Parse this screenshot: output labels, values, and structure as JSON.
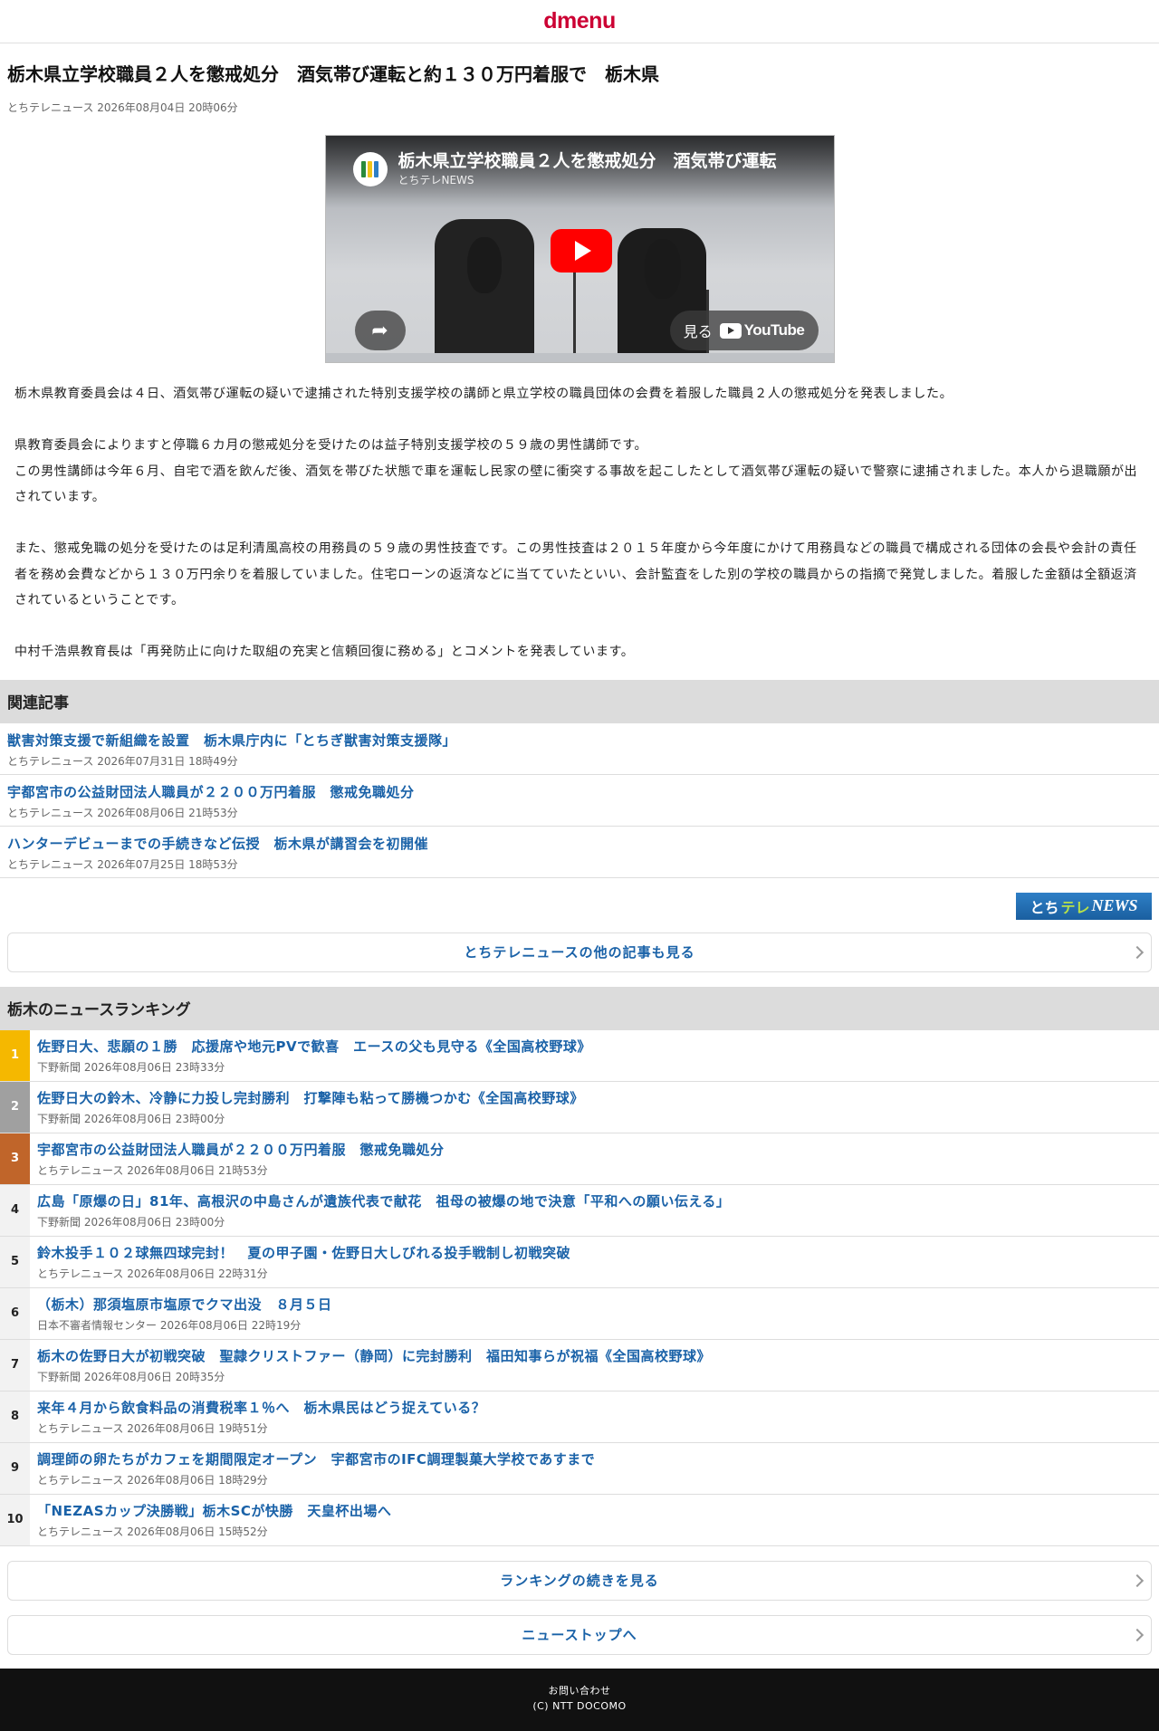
{
  "header": {
    "logo": "dmenu"
  },
  "article": {
    "title": "栃木県立学校職員２人を懲戒処分　酒気帯び運転と約１３０万円着服で　栃木県",
    "source": "とちテレニュース",
    "datetime": "2026年08月04日 20時06分",
    "video": {
      "title": "栃木県立学校職員２人を懲戒処分　酒気帯び運転",
      "channel": "とちテレNEWS",
      "watch_label": "見る",
      "youtube_label": "YouTube"
    },
    "paragraphs": [
      "栃木県教育委員会は４日、酒気帯び運転の疑いで逮捕された特別支援学校の講師と県立学校の職員団体の会費を着服した職員２人の懲戒処分を発表しました。",
      "",
      "県教育委員会によりますと停職６カ月の懲戒処分を受けたのは益子特別支援学校の５９歳の男性講師です。",
      "この男性講師は今年６月、自宅で酒を飲んだ後、酒気を帯びた状態で車を運転し民家の壁に衝突する事故を起こしたとして酒気帯び運転の疑いで警察に逮捕されました。本人から退職願が出されています。",
      "",
      "また、懲戒免職の処分を受けたのは足利清風高校の用務員の５９歳の男性技査です。この男性技査は２０１５年度から今年度にかけて用務員などの職員で構成される団体の会長や会計の責任者を務め会費などから１３０万円余りを着服していました。住宅ローンの返済などに当てていたといい、会計監査をした別の学校の職員からの指摘で発覚しました。着服した金額は全額返済されているということです。",
      "",
      "中村千浩県教育長は「再発防止に向けた取組の充実と信頼回復に務める」とコメントを発表しています。"
    ]
  },
  "related": {
    "heading": "関連記事",
    "items": [
      {
        "title": "獣害対策支援で新組織を設置　栃木県庁内に「とちぎ獣害対策支援隊」",
        "source": "とちテレニュース",
        "datetime": "2026年07月31日 18時49分"
      },
      {
        "title": "宇都宮市の公益財団法人職員が２２００万円着服　懲戒免職処分",
        "source": "とちテレニュース",
        "datetime": "2026年08月06日 21時53分"
      },
      {
        "title": "ハンターデビューまでの手続きなど伝授　栃木県が講習会を初開催",
        "source": "とちテレニュース",
        "datetime": "2026年07月25日 18時53分"
      }
    ],
    "brand_logo": {
      "prefix": "とち",
      "mid": "テレ",
      "suffix": "NEWS"
    },
    "more_label": "とちテレニュースの他の記事も見る"
  },
  "ranking": {
    "heading": "栃木のニュースランキング",
    "items": [
      {
        "rank": "1",
        "title": "佐野日大、悲願の１勝　応援席や地元PVで歓喜　エースの父も見守る《全国高校野球》",
        "source": "下野新聞",
        "datetime": "2026年08月06日 23時33分"
      },
      {
        "rank": "2",
        "title": "佐野日大の鈴木、冷静に力投し完封勝利　打撃陣も粘って勝機つかむ《全国高校野球》",
        "source": "下野新聞",
        "datetime": "2026年08月06日 23時00分"
      },
      {
        "rank": "3",
        "title": "宇都宮市の公益財団法人職員が２２００万円着服　懲戒免職処分",
        "source": "とちテレニュース",
        "datetime": "2026年08月06日 21時53分"
      },
      {
        "rank": "4",
        "title": "広島「原爆の日」81年、高根沢の中島さんが遺族代表で献花　祖母の被爆の地で決意「平和への願い伝える」",
        "source": "下野新聞",
        "datetime": "2026年08月06日 23時00分"
      },
      {
        "rank": "5",
        "title": "鈴木投手１０２球無四球完封！　夏の甲子園・佐野日大しびれる投手戦制し初戦突破",
        "source": "とちテレニュース",
        "datetime": "2026年08月06日 22時31分"
      },
      {
        "rank": "6",
        "title": "（栃木）那須塩原市塩原でクマ出没　８月５日",
        "source": "日本不審者情報センター",
        "datetime": "2026年08月06日 22時19分"
      },
      {
        "rank": "7",
        "title": "栃木の佐野日大が初戦突破　聖隷クリストファー（静岡）に完封勝利　福田知事らが祝福《全国高校野球》",
        "source": "下野新聞",
        "datetime": "2026年08月06日 20時35分"
      },
      {
        "rank": "8",
        "title": "来年４月から飲食料品の消費税率１％へ　栃木県民はどう捉えている？",
        "source": "とちテレニュース",
        "datetime": "2026年08月06日 19時51分"
      },
      {
        "rank": "9",
        "title": "調理師の卵たちがカフェを期間限定オープン　宇都宮市のIFC調理製菓大学校であすまで",
        "source": "とちテレニュース",
        "datetime": "2026年08月06日 18時29分"
      },
      {
        "rank": "10",
        "title": "「NEZASカップ決勝戦」栃木SCが快勝　天皇杯出場へ",
        "source": "とちテレニュース",
        "datetime": "2026年08月06日 15時52分"
      }
    ],
    "more_label": "ランキングの続きを見る",
    "top_label": "ニューストップへ"
  },
  "footer": {
    "contact": "お問い合わせ",
    "copyright": "(C) NTT DOCOMO"
  },
  "colors": {
    "brand": "#cc0033",
    "link": "#1a62a8",
    "rank_gold": "#f5b800",
    "rank_silver": "#a0a0a0",
    "rank_bronze": "#c0652a",
    "youtube_red": "#ff0000"
  }
}
